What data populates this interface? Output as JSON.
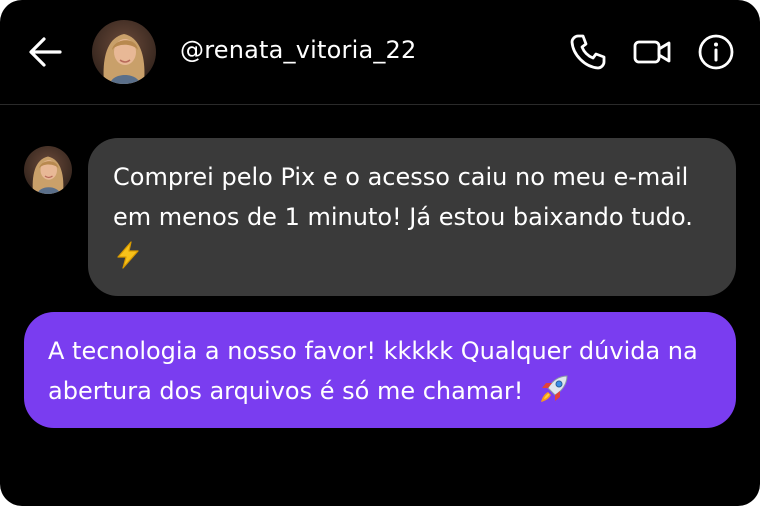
{
  "header": {
    "username": "@renata_vitoria_22",
    "back_icon": "arrow-left-icon",
    "actions": [
      {
        "icon": "phone-icon",
        "label": "call"
      },
      {
        "icon": "video-camera-icon",
        "label": "video"
      },
      {
        "icon": "info-icon",
        "label": "info"
      }
    ]
  },
  "messages": [
    {
      "direction": "incoming",
      "line1": "Comprei pelo Pix e o acesso caiu no meu e-mail",
      "line2": "em menos de 1 minuto! Já estou baixando tudo.",
      "emoji": "⚡",
      "emoji_icon": "lightning-emoji",
      "bubble_color": "#3a3a3a"
    },
    {
      "direction": "outgoing",
      "line1": "A tecnologia a nosso favor! kkkkk Qualquer dúvida na",
      "line2": "abertura dos arquivos é só me chamar!",
      "emoji": "🚀",
      "emoji_icon": "rocket-emoji",
      "bubble_color": "#7a3df0"
    }
  ],
  "colors": {
    "background": "#000000",
    "text": "#ffffff",
    "incoming_bubble": "#3a3a3a",
    "outgoing_bubble": "#7a3df0"
  }
}
